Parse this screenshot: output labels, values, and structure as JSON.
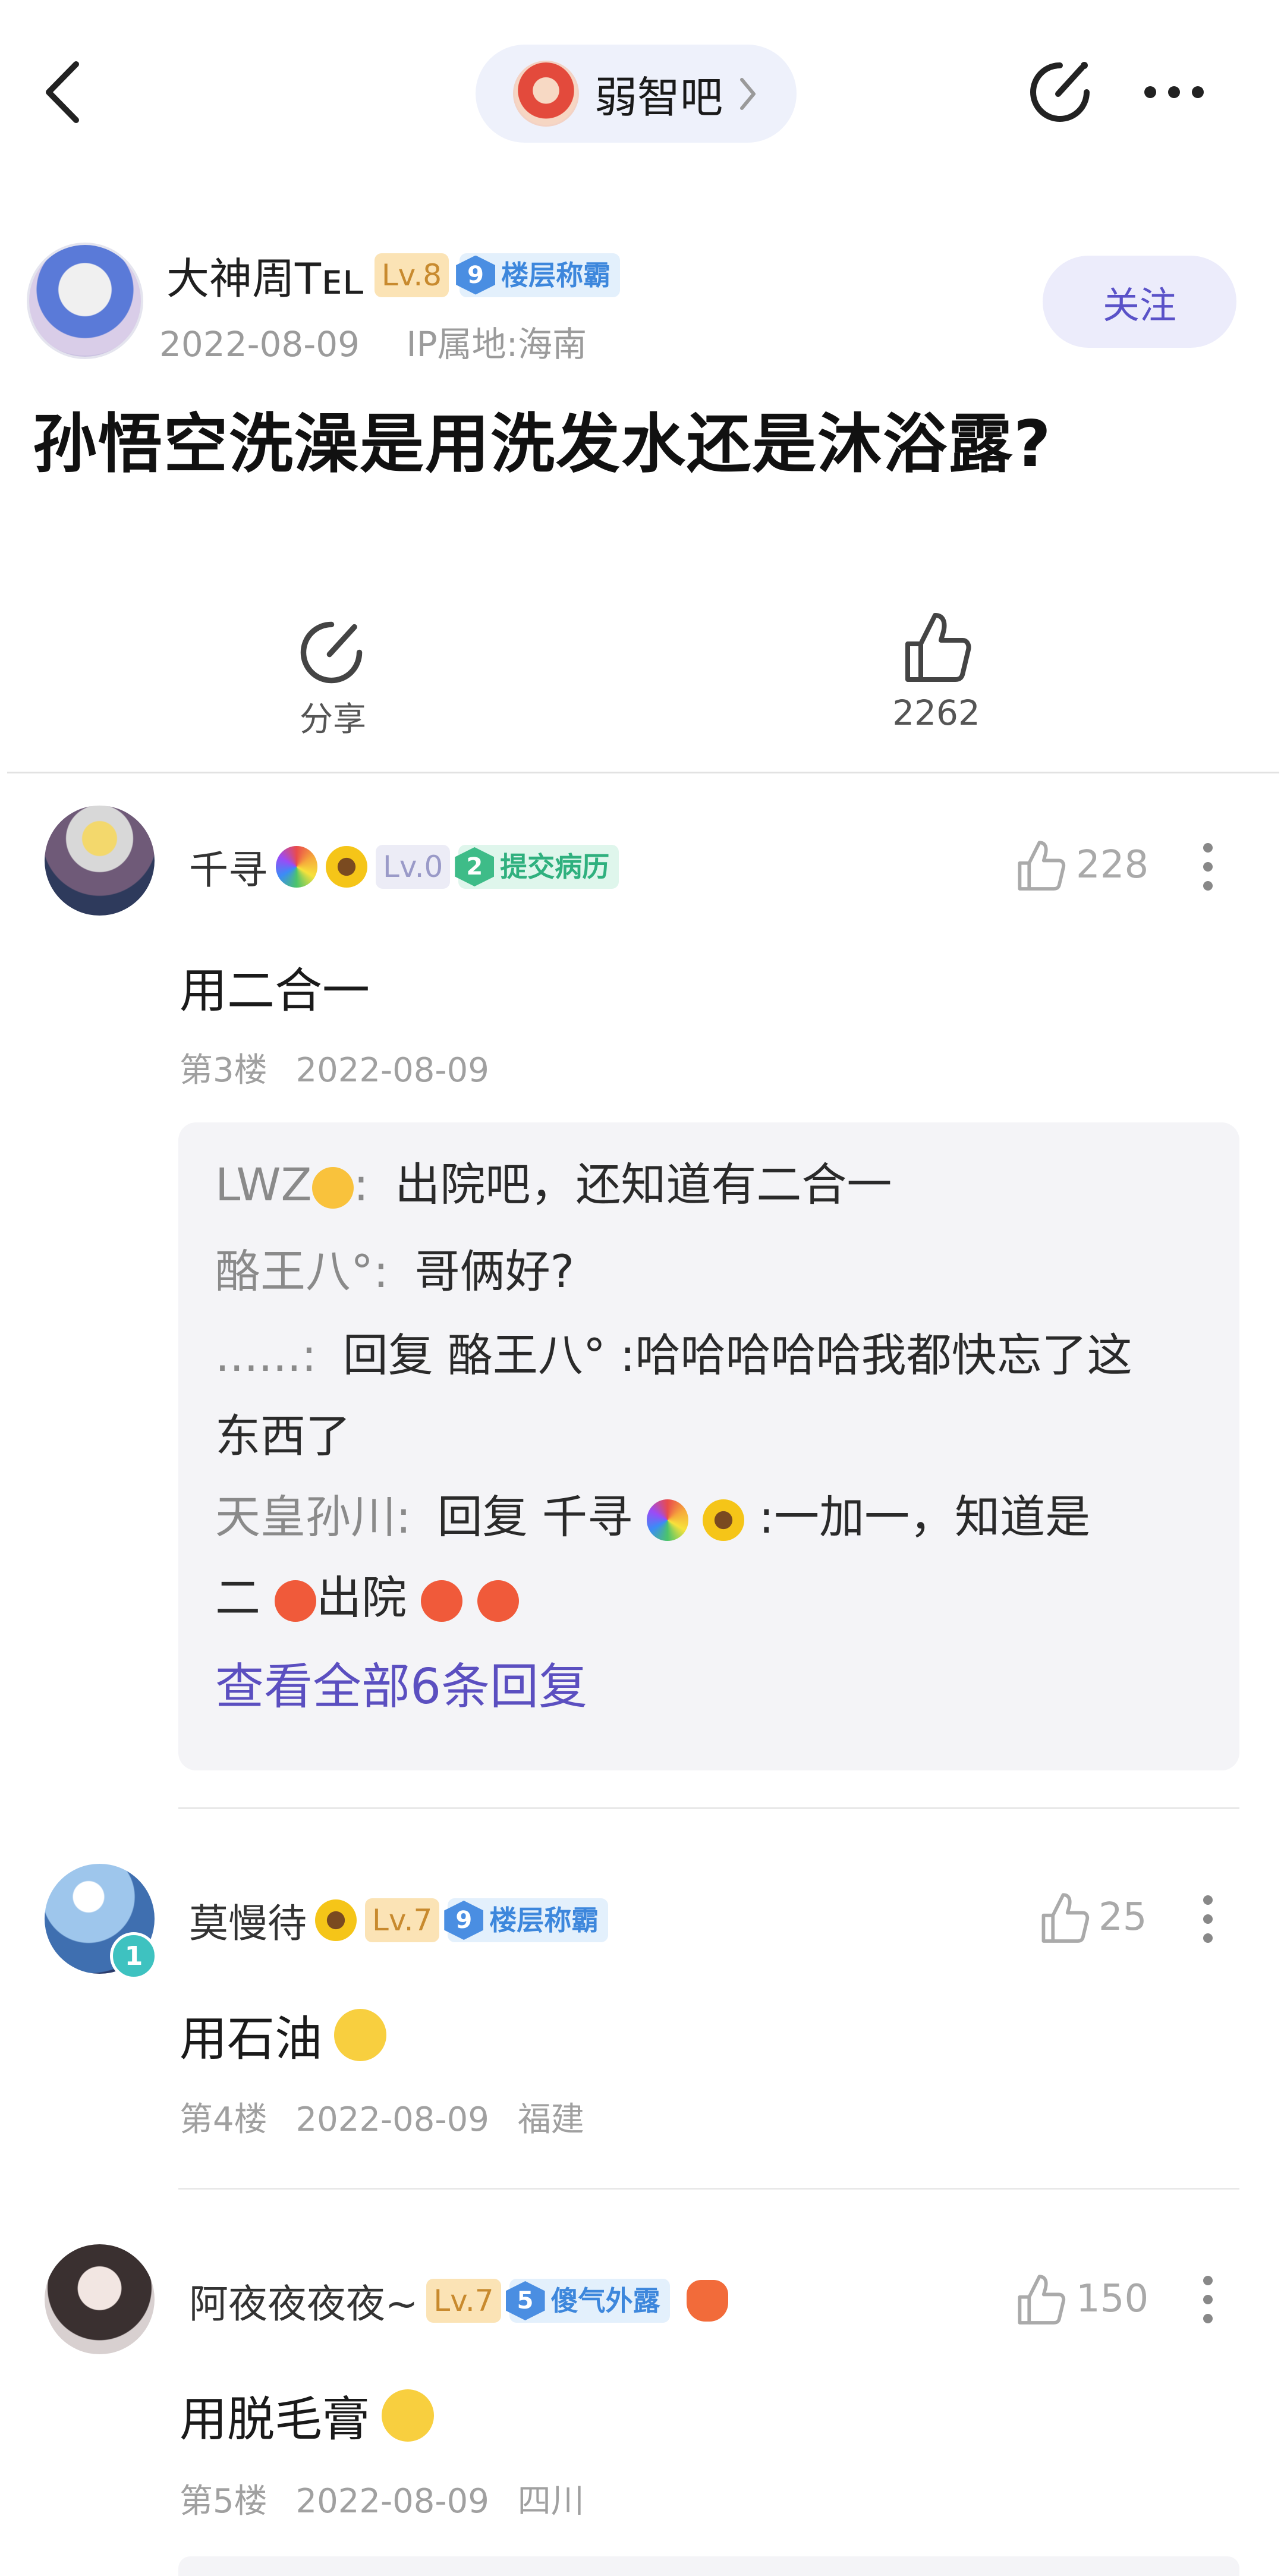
{
  "topbar": {
    "forum_name": "弱智吧"
  },
  "post": {
    "author": {
      "name": "大神周Tᴇʟ",
      "level": "Lv.8",
      "title_num": "9",
      "title": "楼层称霸",
      "date": "2022-08-09",
      "ip": "IP属地:海南"
    },
    "follow_label": "关注",
    "title": "孙悟空洗澡是用洗发水还是沐浴露?",
    "share_label": "分享",
    "like_count": "2262"
  },
  "comments": [
    {
      "name": "千寻",
      "level": "Lv.0",
      "title_num": "2",
      "title": "提交病历",
      "likes": "228",
      "text": "用二合一",
      "floor": "第3楼",
      "date": "2022-08-09",
      "location": "",
      "replies": [
        {
          "who": "LWZ",
          "sep": ":",
          "text": "出院吧，还知道有二合一"
        },
        {
          "who": "酪王八°",
          "sep": ":",
          "text": "哥俩好?"
        },
        {
          "who": "......",
          "sep": ":",
          "text": "回复 酪王八° :哈哈哈哈哈我都快忘了这",
          "text2": "东西了"
        },
        {
          "who": "天皇孙川",
          "sep": ":",
          "text_a": "回复 千寻",
          "text_b": ":一加一，知道是",
          "line2_a": "二",
          "line2_b": "出院"
        }
      ],
      "view_all": "查看全部6条回复"
    },
    {
      "name": "莫慢待",
      "level": "Lv.7",
      "title_num": "9",
      "title": "楼层称霸",
      "likes": "25",
      "text": "用石油",
      "floor": "第4楼",
      "date": "2022-08-09",
      "location": "福建",
      "avatar_badge": "1"
    },
    {
      "name": "阿夜夜夜夜~",
      "level": "Lv.7",
      "title_num": "5",
      "title": "傻气外露",
      "likes": "150",
      "text": "用脱毛膏",
      "floor": "第5楼",
      "date": "2022-08-09",
      "location": "四川"
    }
  ],
  "colors": {
    "accent": "#5b4fc0",
    "title_blue": "#3d87dc",
    "title_green": "#2fb07e",
    "level_gold": "#c88a2e"
  },
  "icons": [
    "back-icon",
    "chevron-right-icon",
    "edit-icon",
    "more-icon",
    "share-icon",
    "thumbs-up-icon",
    "more-vertical-icon",
    "rainbow-emoji",
    "sunflower-emoji",
    "sad-emoji",
    "angry-emoji",
    "smile-emoji",
    "yum-emoji",
    "gamepad-emoji"
  ]
}
